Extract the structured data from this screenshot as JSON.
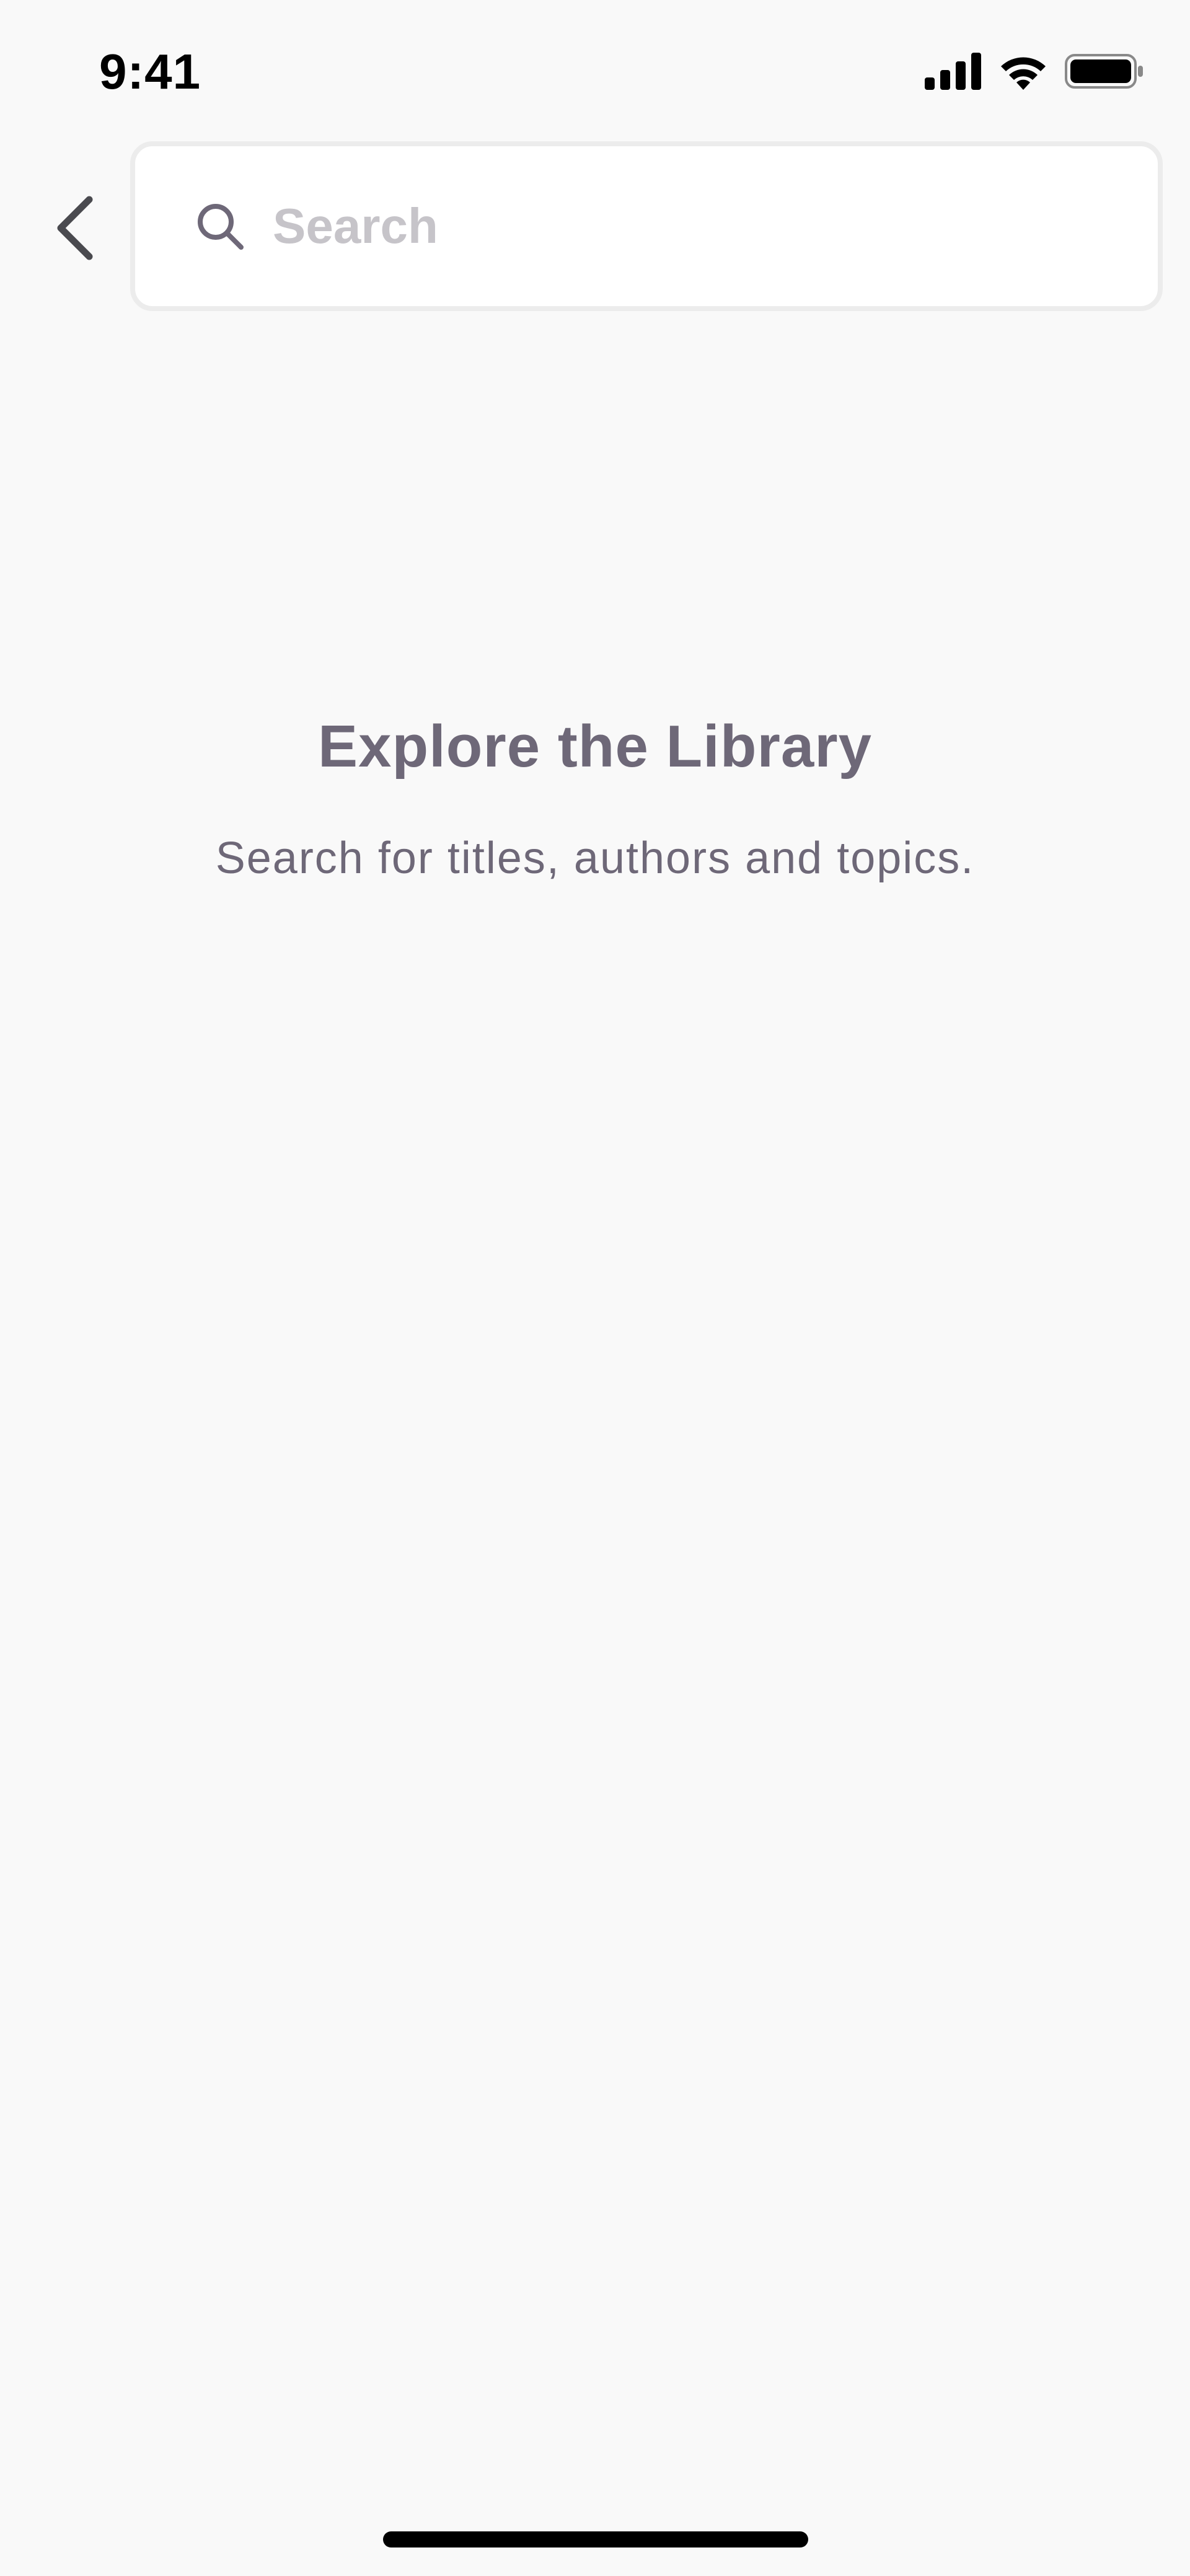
{
  "status_bar": {
    "time": "9:41",
    "icons": [
      "signal-icon",
      "wifi-icon",
      "battery-icon"
    ]
  },
  "header": {
    "back_icon": "chevron-left-icon",
    "search": {
      "icon": "search-icon",
      "placeholder": "Search",
      "value": ""
    }
  },
  "empty_state": {
    "title": "Explore the Library",
    "subtitle": "Search for titles, authors and topics."
  },
  "colors": {
    "background": "#f9f9f9",
    "text_primary": "#6e6878",
    "placeholder": "#c6c4c9",
    "search_border": "#ececec"
  }
}
